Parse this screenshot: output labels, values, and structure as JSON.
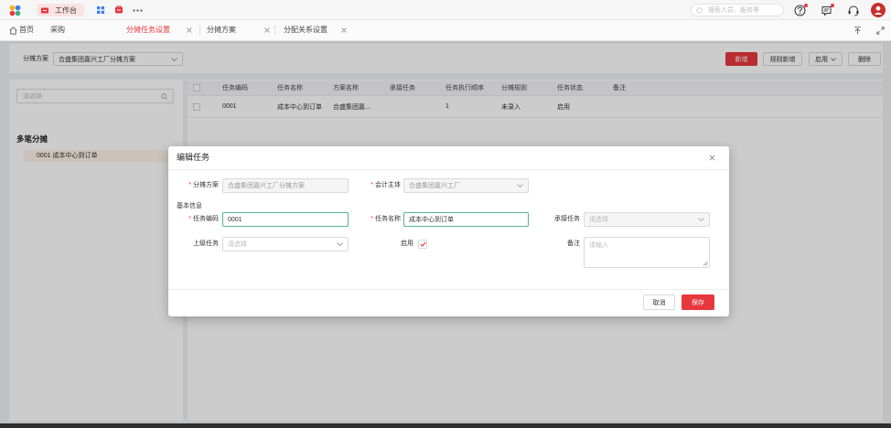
{
  "topbar": {
    "workbench_label": "工作台",
    "search_placeholder": "搜索人员、服务等"
  },
  "nav_tabs": {
    "home_label": "首页",
    "purchase_label": "采购",
    "tabs": [
      {
        "label": "分摊任务设置",
        "active": true
      },
      {
        "label": "分摊方案",
        "active": false
      },
      {
        "label": "分配关系设置",
        "active": false
      }
    ]
  },
  "toolbar": {
    "scheme_label": "分摊方案",
    "scheme_value": "合盛集团嘉兴工厂分摊方案",
    "add_label": "新增",
    "rule_add_label": "规则新增",
    "enable_label": "启用",
    "delete_label": "删除"
  },
  "sidebar": {
    "search_placeholder": "请选择",
    "group_title": "多笔分摊",
    "items": [
      {
        "label": "0001 成本中心到订单",
        "selected": true
      }
    ]
  },
  "table": {
    "columns": [
      "任务编码",
      "任务名称",
      "方案名称",
      "承接任务",
      "任务执行顺序",
      "分摊规则",
      "任务状态",
      "备注"
    ],
    "rows": [
      {
        "code": "0001",
        "name": "成本中心到订单",
        "scheme": "合盛集团嘉...",
        "order": "1",
        "rule": "未录入",
        "status": "启用"
      }
    ]
  },
  "modal": {
    "title": "编辑任务",
    "required_mark": "*",
    "scheme": {
      "label": "分摊方案",
      "value": "合盛集团嘉兴工厂分摊方案",
      "disabled": true
    },
    "accounting_entity": {
      "label": "会计主体",
      "value": "合盛集团嘉兴工厂",
      "disabled": true
    },
    "section_title": "基本信息",
    "task_code": {
      "label": "任务编码",
      "value": "0001"
    },
    "task_name": {
      "label": "任务名称",
      "value": "成本中心到订单"
    },
    "receive_task": {
      "label": "承接任务",
      "placeholder": "请选择",
      "disabled": true
    },
    "parent_task": {
      "label": "上级任务",
      "placeholder": "请选择"
    },
    "enabled": {
      "label": "启用",
      "checked": true
    },
    "remark": {
      "label": "备注",
      "placeholder": "请输入"
    },
    "cancel_label": "取消",
    "save_label": "保存"
  },
  "colors": {
    "accent": "#e8383d",
    "focus_border": "#52b788",
    "avatar": "#c6302c"
  }
}
